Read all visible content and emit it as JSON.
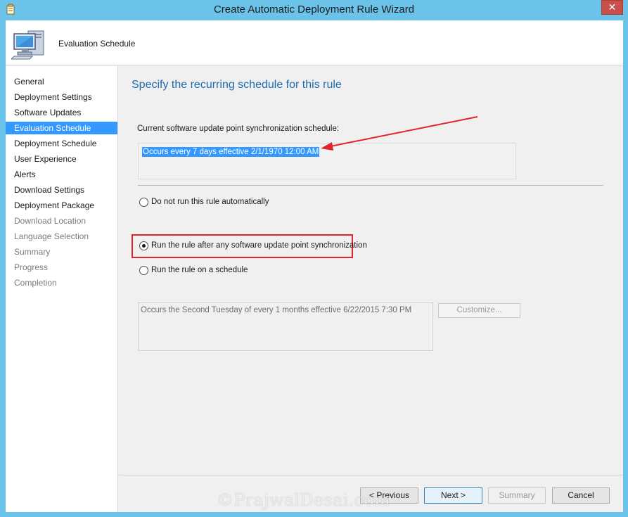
{
  "window": {
    "title": "Create Automatic Deployment Rule Wizard",
    "close_glyph": "✕"
  },
  "header": {
    "title": "Evaluation Schedule",
    "icon": "computer-icon"
  },
  "nav": {
    "items": [
      {
        "label": "General",
        "state": "normal"
      },
      {
        "label": "Deployment Settings",
        "state": "normal"
      },
      {
        "label": "Software Updates",
        "state": "normal"
      },
      {
        "label": "Evaluation Schedule",
        "state": "active"
      },
      {
        "label": "Deployment Schedule",
        "state": "normal"
      },
      {
        "label": "User Experience",
        "state": "normal"
      },
      {
        "label": "Alerts",
        "state": "normal"
      },
      {
        "label": "Download Settings",
        "state": "normal"
      },
      {
        "label": "Deployment Package",
        "state": "normal"
      },
      {
        "label": "Download Location",
        "state": "disabled"
      },
      {
        "label": "Language Selection",
        "state": "disabled"
      },
      {
        "label": "Summary",
        "state": "disabled"
      },
      {
        "label": "Progress",
        "state": "disabled"
      },
      {
        "label": "Completion",
        "state": "disabled"
      }
    ]
  },
  "main": {
    "heading": "Specify the recurring schedule for this rule",
    "sync_label": "Current software update point synchronization schedule:",
    "sync_value": "Occurs every 7 days effective 2/1/1970 12:00 AM",
    "options": [
      {
        "label": "Do not run this rule automatically",
        "selected": false
      },
      {
        "label": "Run the rule after any software update point synchronization",
        "selected": true
      },
      {
        "label": "Run the rule on a schedule",
        "selected": false
      }
    ],
    "schedule_value": "Occurs the Second Tuesday of every 1 months effective 6/22/2015 7:30 PM",
    "customize_label": "Customize..."
  },
  "footer": {
    "previous_label": "< Previous",
    "next_label": "Next >",
    "summary_label": "Summary",
    "cancel_label": "Cancel"
  },
  "annotations": {
    "arrow_color": "#e0232e",
    "highlight_color": "#e0232e"
  },
  "watermark": "©PrajwalDesai.com"
}
